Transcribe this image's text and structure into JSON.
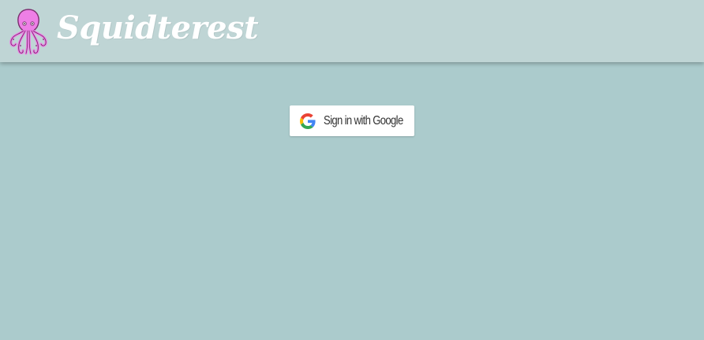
{
  "header": {
    "brand_name": "Squidterest",
    "logo_icon": "squid-logo-icon"
  },
  "auth": {
    "google_button_label": "Sign in with Google",
    "google_icon": "google-g-icon"
  },
  "colors": {
    "page_background": "#abcbcc",
    "header_background": "#bfd5d5",
    "brand_text": "#ffffff",
    "logo_primary": "#ee7fe6",
    "logo_outline": "#7a2f6e"
  }
}
